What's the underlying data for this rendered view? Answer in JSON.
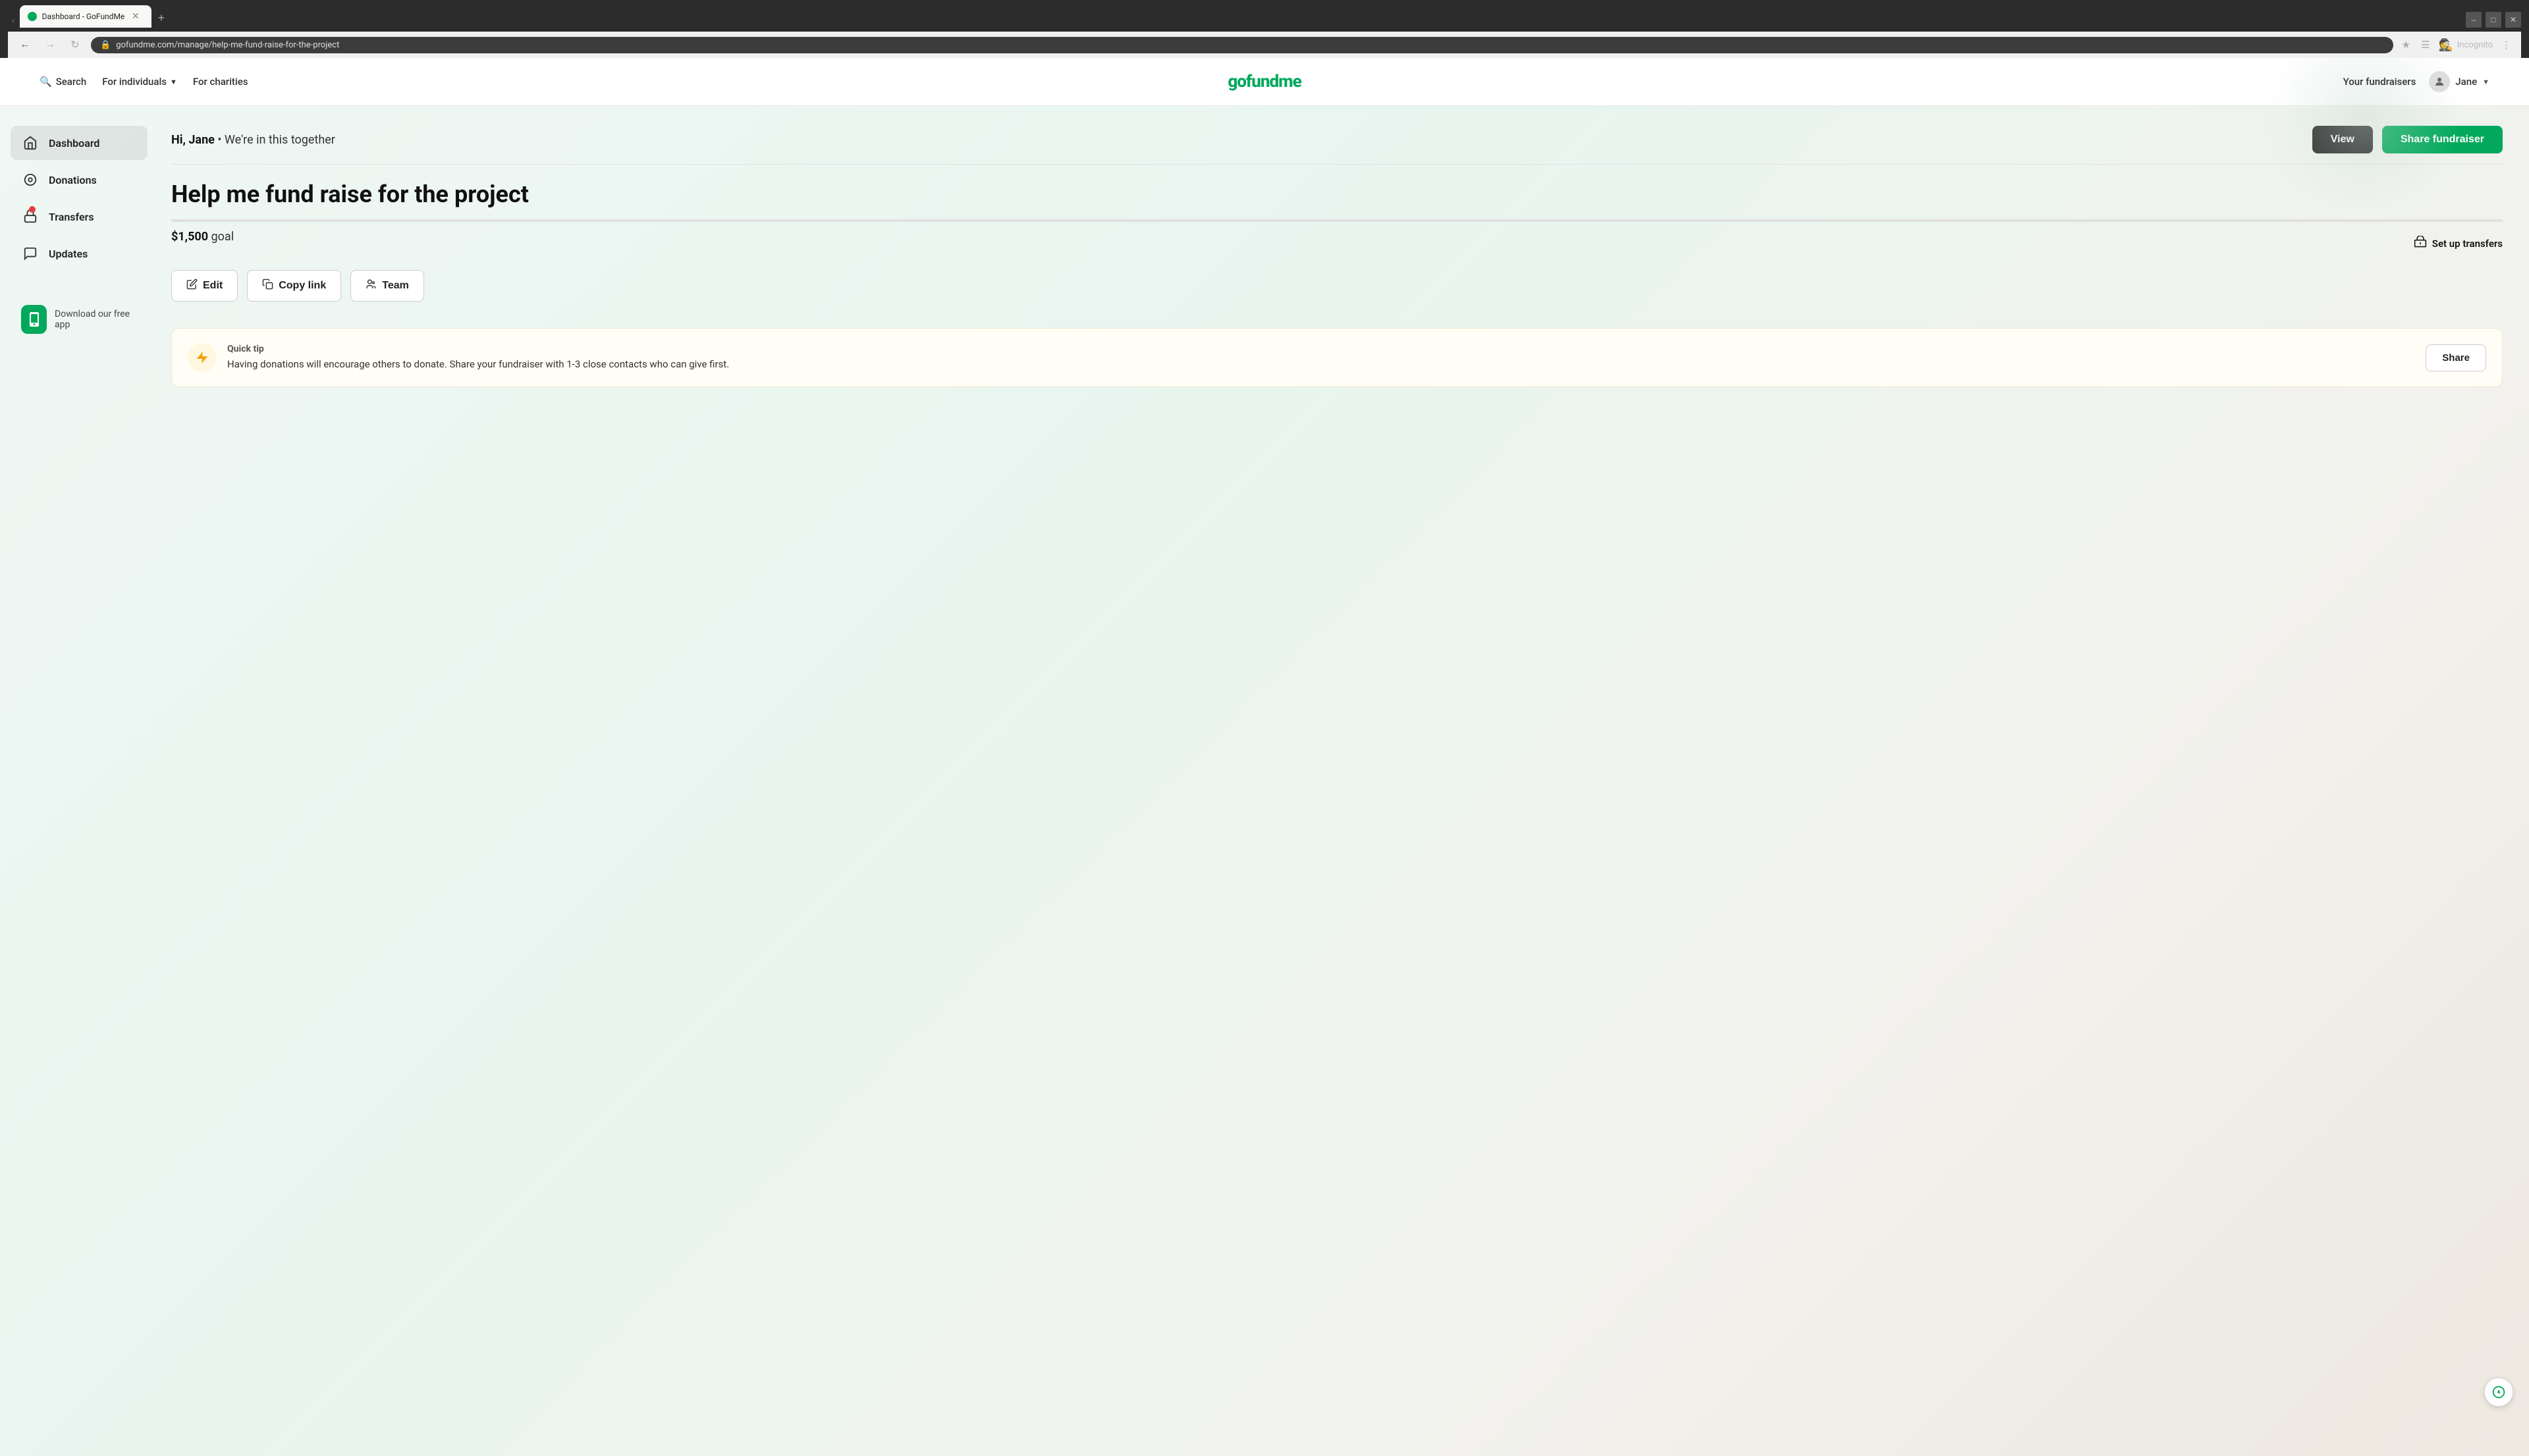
{
  "browser": {
    "url": "gofundme.com/manage/help-me-fund-raise-for-the-project",
    "tab_label": "Dashboard - GoFundMe",
    "incognito_label": "Incognito"
  },
  "header": {
    "search_label": "Search",
    "for_individuals_label": "For individuals",
    "for_charities_label": "For charities",
    "logo_text": "gofundme",
    "your_fundraisers_label": "Your fundraisers",
    "user_name": "Jane"
  },
  "sidebar": {
    "items": [
      {
        "label": "Dashboard",
        "icon": "🏠",
        "active": true,
        "badge": false
      },
      {
        "label": "Donations",
        "icon": "◎",
        "active": false,
        "badge": false
      },
      {
        "label": "Transfers",
        "icon": "🏛",
        "active": false,
        "badge": true
      },
      {
        "label": "Updates",
        "icon": "💬",
        "active": false,
        "badge": false
      }
    ],
    "download_app_label": "Download our free app"
  },
  "dashboard": {
    "greeting": "Hi, Jane",
    "subtitle": "We're in this together",
    "view_button": "View",
    "share_button": "Share fundraiser"
  },
  "fundraiser": {
    "title": "Help me fund raise for the project",
    "goal_amount": "$1,500",
    "goal_label": "goal",
    "progress_percent": 0,
    "setup_transfers_label": "Set up transfers",
    "edit_button": "Edit",
    "copy_link_button": "Copy link",
    "team_button": "Team"
  },
  "quick_tip": {
    "badge_label": "Quick tip",
    "text": "Having donations will encourage others to donate. Share your fundraiser with 1-3 close contacts who can give first.",
    "share_button": "Share"
  }
}
